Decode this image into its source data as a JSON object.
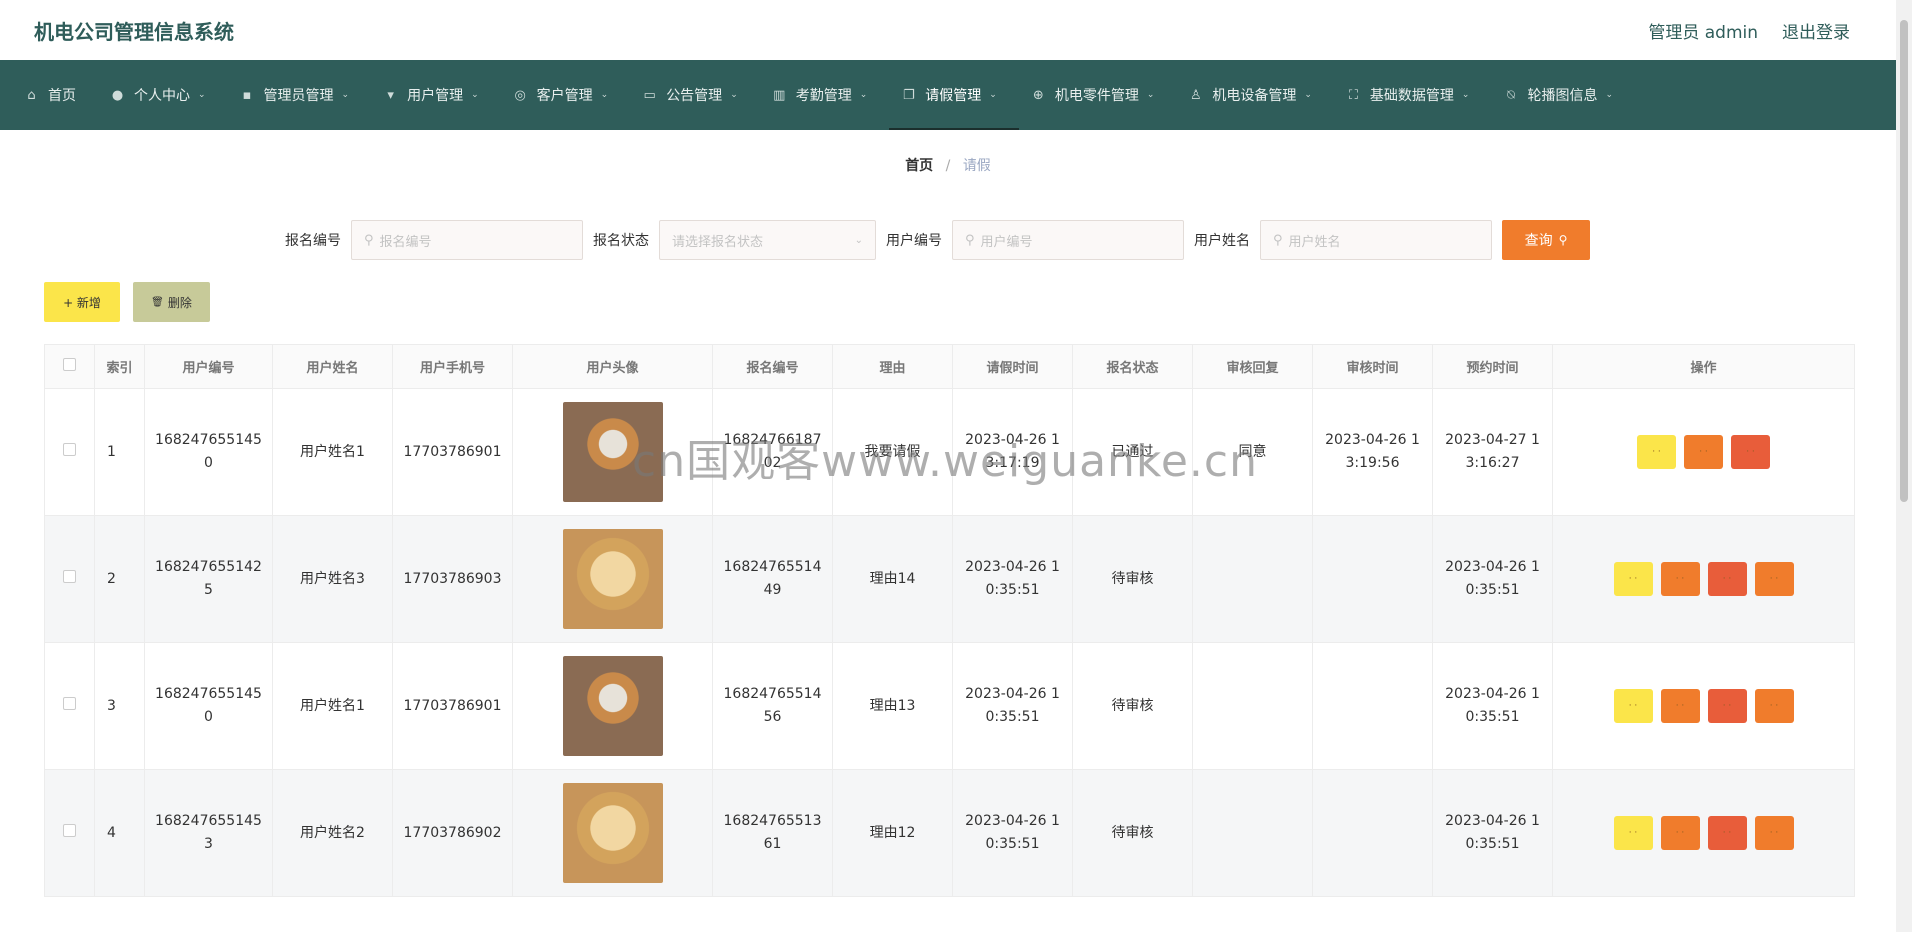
{
  "header": {
    "title": "机电公司管理信息系统",
    "user": "管理员 admin",
    "logout": "退出登录"
  },
  "nav": [
    {
      "label": "首页",
      "icon": "home-icon",
      "chevron": false
    },
    {
      "label": "个人中心",
      "icon": "user-icon",
      "chevron": true
    },
    {
      "label": "管理员管理",
      "icon": "admin-icon",
      "chevron": true
    },
    {
      "label": "用户管理",
      "icon": "brush-icon",
      "chevron": true
    },
    {
      "label": "客户管理",
      "icon": "compass-icon",
      "chevron": true
    },
    {
      "label": "公告管理",
      "icon": "message-icon",
      "chevron": true
    },
    {
      "label": "考勤管理",
      "icon": "calendar-icon",
      "chevron": true
    },
    {
      "label": "请假管理",
      "icon": "copy-icon",
      "chevron": true,
      "active": true
    },
    {
      "label": "机电零件管理",
      "icon": "aim-icon",
      "chevron": true
    },
    {
      "label": "机电设备管理",
      "icon": "person-icon",
      "chevron": true
    },
    {
      "label": "基础数据管理",
      "icon": "fullscreen-icon",
      "chevron": true
    },
    {
      "label": "轮播图信息",
      "icon": "bell-off-icon",
      "chevron": true
    }
  ],
  "breadcrumb": {
    "home": "首页",
    "separator": "/",
    "current": "请假"
  },
  "search": {
    "field1": {
      "label": "报名编号",
      "placeholder": "报名编号"
    },
    "field2": {
      "label": "报名状态",
      "placeholder": "请选择报名状态"
    },
    "field3": {
      "label": "用户编号",
      "placeholder": "用户编号"
    },
    "field4": {
      "label": "用户姓名",
      "placeholder": "用户姓名"
    },
    "query_label": "查询"
  },
  "actions": {
    "add": "+ 新增",
    "delete": "删除"
  },
  "table": {
    "columns": [
      "",
      "索引",
      "用户编号",
      "用户姓名",
      "用户手机号",
      "用户头像",
      "报名编号",
      "理由",
      "请假时间",
      "报名状态",
      "审核回复",
      "审核时间",
      "预约时间",
      "操作"
    ],
    "rows": [
      {
        "index": "1",
        "user_no": "1682476551450",
        "user_name": "用户姓名1",
        "phone": "17703786901",
        "avatar": "shiba",
        "signup_no": "1682476618702",
        "reason": "我要请假",
        "leave_time": "2023-04-26 13:17:19",
        "status": "已通过",
        "reply": "同意",
        "review_time": "2023-04-26 13:19:56",
        "booking_time": "2023-04-27 13:16:27",
        "ops": [
          "y",
          "o",
          "r"
        ]
      },
      {
        "index": "2",
        "user_no": "1682476551425",
        "user_name": "用户姓名3",
        "phone": "17703786903",
        "avatar": "golden",
        "signup_no": "1682476551449",
        "reason": "理由14",
        "leave_time": "2023-04-26 10:35:51",
        "status": "待审核",
        "reply": "",
        "review_time": "",
        "booking_time": "2023-04-26 10:35:51",
        "ops": [
          "y",
          "o",
          "r",
          "o"
        ]
      },
      {
        "index": "3",
        "user_no": "1682476551450",
        "user_name": "用户姓名1",
        "phone": "17703786901",
        "avatar": "shiba",
        "signup_no": "1682476551456",
        "reason": "理由13",
        "leave_time": "2023-04-26 10:35:51",
        "status": "待审核",
        "reply": "",
        "review_time": "",
        "booking_time": "2023-04-26 10:35:51",
        "ops": [
          "y",
          "o",
          "r",
          "o"
        ]
      },
      {
        "index": "4",
        "user_no": "1682476551453",
        "user_name": "用户姓名2",
        "phone": "17703786902",
        "avatar": "golden",
        "signup_no": "1682476551361",
        "reason": "理由12",
        "leave_time": "2023-04-26 10:35:51",
        "status": "待审核",
        "reply": "",
        "review_time": "",
        "booking_time": "2023-04-26 10:35:51",
        "ops": [
          "y",
          "o",
          "r",
          "o"
        ]
      }
    ]
  },
  "watermark": "cn国观客www.weiguanke.cn",
  "colors": {
    "nav_bg": "#2f5d5a",
    "accent_orange": "#f07c2c",
    "accent_yellow": "#fbe54a",
    "delete_bg": "#c7ca99"
  }
}
